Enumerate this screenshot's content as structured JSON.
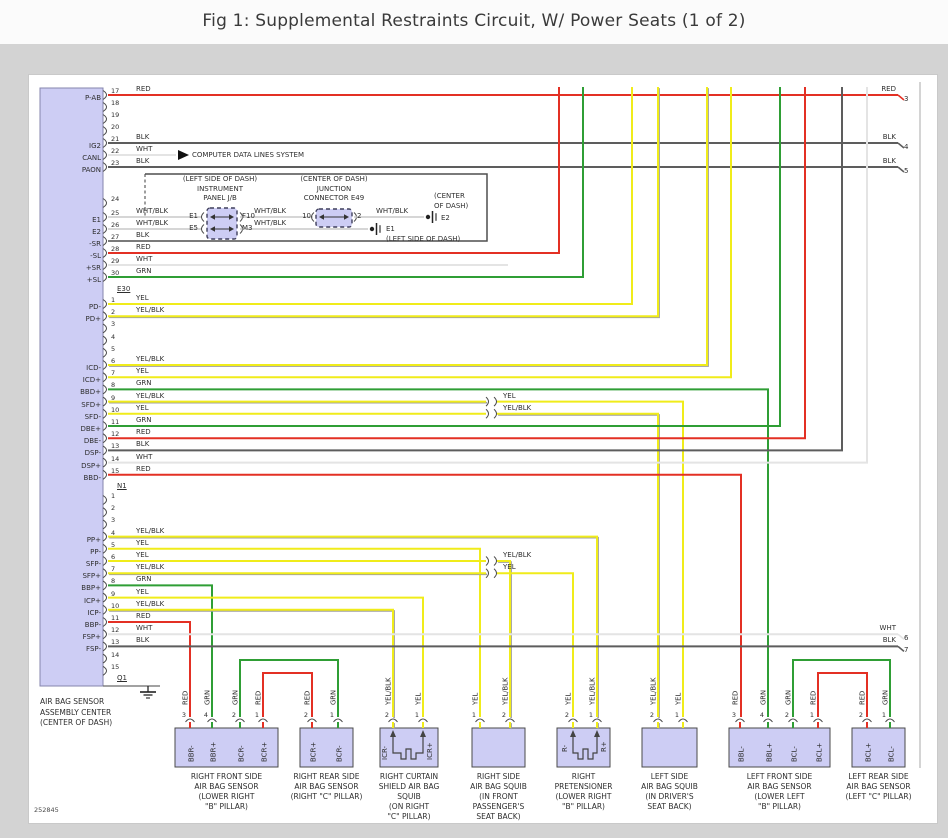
{
  "title": "Fig 1: Supplemental Restraints Circuit, W/ Power Seats (1 of 2)",
  "doc_number": "252845",
  "page": {
    "computer_data_label": "COMPUTER DATA LINES SYSTEM"
  },
  "colors": {
    "RED": "#e33024",
    "GRN": "#2f9e35",
    "YEL": "#f0ec1a",
    "BLK": "#5d5d5d",
    "WHT": "#e4e4e4",
    "WHT/BLK": "#c9c9c9",
    "YEL/BLK": "#f0ec1a"
  },
  "main_connector": {
    "caption": [
      "AIR BAG SENSOR",
      "ASSEMBLY CENTER",
      "(CENTER OF DASH)"
    ],
    "bottom_connector_id": "Q1",
    "sections": [
      {
        "id": "",
        "pins": [
          {
            "n": "17",
            "label": "P-AB",
            "color": "RED"
          },
          {
            "n": "18"
          },
          {
            "n": "19"
          },
          {
            "n": "20"
          },
          {
            "n": "21",
            "label": "IG2",
            "color": "BLK"
          },
          {
            "n": "22",
            "label": "CANL",
            "color": "WHT"
          },
          {
            "n": "23",
            "label": "PAON",
            "color": "BLK"
          },
          {
            "n": "24"
          },
          {
            "n": "25",
            "label": "E1",
            "color": "WHT/BLK"
          },
          {
            "n": "26",
            "label": "E2",
            "color": "WHT/BLK"
          },
          {
            "n": "27",
            "label": "-SR",
            "color": "BLK"
          },
          {
            "n": "28",
            "label": "-SL",
            "color": "RED"
          },
          {
            "n": "29",
            "label": "+SR",
            "color": "WHT"
          },
          {
            "n": "30",
            "label": "+SL",
            "color": "GRN"
          }
        ]
      },
      {
        "id": "E30",
        "pins": [
          {
            "n": "1",
            "label": "PD-",
            "color": "YEL"
          },
          {
            "n": "2",
            "label": "PD+",
            "color": "YEL/BLK"
          },
          {
            "n": "3"
          },
          {
            "n": "4"
          },
          {
            "n": "5"
          },
          {
            "n": "6",
            "label": "ICD-",
            "color": "YEL/BLK"
          },
          {
            "n": "7",
            "label": "ICD+",
            "color": "YEL"
          },
          {
            "n": "8",
            "label": "BBD+",
            "color": "GRN"
          },
          {
            "n": "9",
            "label": "SFD+",
            "color": "YEL/BLK",
            "color2": "YEL"
          },
          {
            "n": "10",
            "label": "SFD-",
            "color": "YEL",
            "color2": "YEL/BLK"
          },
          {
            "n": "11",
            "label": "DBE+",
            "color": "GRN"
          },
          {
            "n": "12",
            "label": "DBE-",
            "color": "RED"
          },
          {
            "n": "13",
            "label": "DSP-",
            "color": "BLK"
          },
          {
            "n": "14",
            "label": "DSP+",
            "color": "WHT"
          },
          {
            "n": "15",
            "label": "BBD-",
            "color": "RED"
          }
        ]
      },
      {
        "id": "N1",
        "pins": [
          {
            "n": "1"
          },
          {
            "n": "2"
          },
          {
            "n": "3"
          },
          {
            "n": "4",
            "label": "PP+",
            "color": "YEL/BLK"
          },
          {
            "n": "5",
            "label": "PP-",
            "color": "YEL"
          },
          {
            "n": "6",
            "label": "SFP-",
            "color": "YEL",
            "color2": "YEL/BLK"
          },
          {
            "n": "7",
            "label": "SFP+",
            "color": "YEL/BLK",
            "color2": "YEL"
          },
          {
            "n": "8",
            "label": "BBP+",
            "color": "GRN"
          },
          {
            "n": "9",
            "label": "ICP+",
            "color": "YEL"
          },
          {
            "n": "10",
            "label": "ICP-",
            "color": "YEL/BLK"
          },
          {
            "n": "11",
            "label": "BBP-",
            "color": "RED"
          },
          {
            "n": "12",
            "label": "FSP+",
            "color": "WHT"
          },
          {
            "n": "13",
            "label": "FSP-",
            "color": "BLK"
          },
          {
            "n": "14"
          },
          {
            "n": "15"
          }
        ]
      }
    ]
  },
  "jb": {
    "caption": [
      "(LEFT SIDE OF DASH)",
      "INSTRUMENT",
      "PANEL J/B"
    ],
    "rows": [
      {
        "in_pin": "E1",
        "out_pin": "F10",
        "mid_color": "WHT/BLK",
        "e49_in": "10",
        "e49_out": "2",
        "end_color": "WHT/BLK",
        "ground": "E2",
        "ground_caption": [
          "(CENTER",
          "OF DASH)"
        ]
      },
      {
        "in_pin": "E5",
        "out_pin": "M3",
        "mid_color": "WHT/BLK",
        "ground": "E1",
        "ground_caption": [
          "(LEFT SIDE OF DASH)"
        ]
      }
    ]
  },
  "e49": {
    "caption": [
      "(CENTER OF DASH)",
      "JUNCTION",
      "CONNECTOR E49"
    ]
  },
  "exits": [
    {
      "n": "3",
      "color": "RED"
    },
    {
      "n": "4",
      "color": "BLK"
    },
    {
      "n": "5",
      "color": "BLK"
    },
    {
      "n": "6",
      "color": "WHT"
    },
    {
      "n": "7",
      "color": "BLK"
    }
  ],
  "boxes": [
    {
      "caption": [
        "RIGHT FRONT SIDE",
        "AIR BAG SENSOR",
        "(LOWER RIGHT",
        "\"B\" PILLAR)"
      ],
      "pins": [
        {
          "n": "3",
          "label": "BBR-",
          "color": "RED"
        },
        {
          "n": "4",
          "label": "BBR+",
          "color": "GRN"
        },
        {
          "n": "2",
          "label": "BCR-",
          "color": "GRN"
        },
        {
          "n": "1",
          "label": "BCR+",
          "color": "RED"
        }
      ]
    },
    {
      "caption": [
        "RIGHT REAR SIDE",
        "AIR BAG SENSOR",
        "(RIGHT \"C\" PILLAR)"
      ],
      "pins": [
        {
          "n": "2",
          "label": "BCR+",
          "color": "RED"
        },
        {
          "n": "1",
          "label": "BCR-",
          "color": "GRN"
        }
      ]
    },
    {
      "caption": [
        "RIGHT CURTAIN",
        "SHIELD AIR BAG",
        "SQUIB",
        "(ON RIGHT",
        "\"C\" PILLAR)"
      ],
      "pins": [
        {
          "n": "2",
          "label": "ICR-",
          "color": "YEL/BLK"
        },
        {
          "n": "1",
          "label": "ICR+",
          "color": "YEL"
        }
      ]
    },
    {
      "caption": [
        "RIGHT SIDE",
        "AIR BAG SQUIB",
        "(IN FRONT",
        "PASSENGER'S",
        "SEAT BACK)"
      ],
      "pins": [
        {
          "n": "1",
          "label": "",
          "color": "YEL"
        },
        {
          "n": "2",
          "label": "",
          "color": "YEL/BLK"
        }
      ]
    },
    {
      "caption": [
        "RIGHT",
        "PRETENSIONER",
        "(LOWER RIGHT",
        "\"B\" PILLAR)"
      ],
      "pins": [
        {
          "n": "2",
          "label": "R-",
          "color": "YEL"
        },
        {
          "n": "1",
          "label": "R+",
          "color": "YEL/BLK"
        }
      ]
    },
    {
      "caption": [
        "LEFT SIDE",
        "AIR BAG SQUIB",
        "(IN DRIVER'S",
        "SEAT BACK)"
      ],
      "pins": [
        {
          "n": "2",
          "label": "",
          "color": "YEL/BLK"
        },
        {
          "n": "1",
          "label": "",
          "color": "YEL"
        }
      ]
    },
    {
      "caption": [
        "LEFT FRONT SIDE",
        "AIR BAG SENSOR",
        "(LOWER LEFT",
        "\"B\" PILLAR)"
      ],
      "pins": [
        {
          "n": "3",
          "label": "BBL-",
          "color": "RED"
        },
        {
          "n": "4",
          "label": "BBL+",
          "color": "GRN"
        },
        {
          "n": "2",
          "label": "BCL-",
          "color": "GRN"
        },
        {
          "n": "1",
          "label": "BCL+",
          "color": "RED"
        }
      ]
    },
    {
      "caption": [
        "LEFT REAR SIDE",
        "AIR BAG SENSOR",
        "(LEFT \"C\" PILLAR)"
      ],
      "pins": [
        {
          "n": "2",
          "label": "BCL+",
          "color": "RED"
        },
        {
          "n": "1",
          "label": "BCL-",
          "color": "GRN"
        }
      ]
    }
  ]
}
